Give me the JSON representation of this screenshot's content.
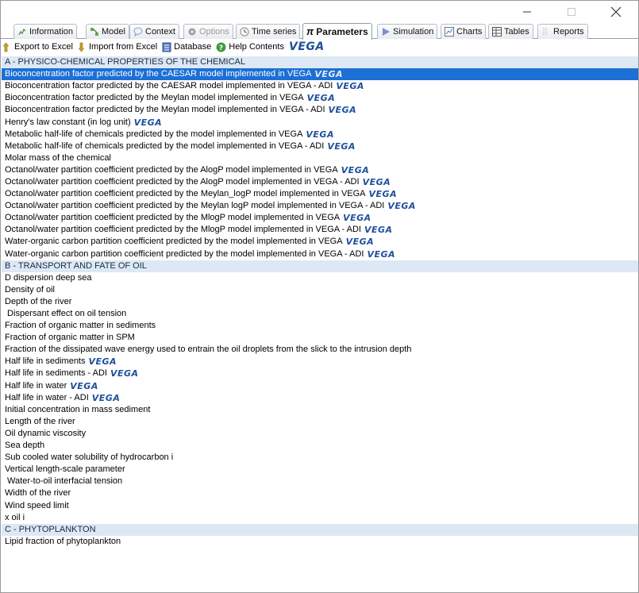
{
  "window": {
    "controls": {
      "minimize": "–",
      "maximize": "☐",
      "close": "✕"
    }
  },
  "tabs": [
    {
      "label": "Information",
      "icon": "info-icon",
      "state": "normal"
    },
    {
      "label": "Model",
      "icon": "model-icon",
      "state": "normal"
    },
    {
      "label": "Context",
      "icon": "context-bubble-icon",
      "state": "normal"
    },
    {
      "label": "Options",
      "icon": "options-gear-icon",
      "state": "disabled"
    },
    {
      "label": "Time series",
      "icon": "clock-icon",
      "state": "normal"
    },
    {
      "label": "Parameters",
      "icon": "pi-icon",
      "state": "active"
    },
    {
      "label": "Simulation",
      "icon": "play-icon",
      "state": "normal"
    },
    {
      "label": "Charts",
      "icon": "chart-icon",
      "state": "normal"
    },
    {
      "label": "Tables",
      "icon": "table-icon",
      "state": "normal"
    },
    {
      "label": "Reports",
      "icon": "report-icon",
      "state": "normal"
    }
  ],
  "toolbar": {
    "export_label": "Export to Excel",
    "import_label": "Import from Excel",
    "database_label": "Database",
    "help_label": "Help Contents",
    "vega_logo": "VEGA"
  },
  "vega_badge": "VEGA",
  "colors": {
    "selection": "#1c6fd4",
    "section_header": "#dde8f5",
    "vega_blue": "#1e4f9a"
  },
  "sections": [
    {
      "title": "A - PHYSICO-CHEMICAL PROPERTIES OF THE CHEMICAL",
      "items": [
        {
          "label": "Bioconcentration factor predicted by the CAESAR model implemented in VEGA",
          "vega": true,
          "selected": true
        },
        {
          "label": "Bioconcentration factor predicted by the CAESAR model implemented in VEGA - ADI",
          "vega": true
        },
        {
          "label": "Bioconcentration factor predicted by the Meylan model implemented in VEGA",
          "vega": true
        },
        {
          "label": "Bioconcentration factor predicted by the Meylan model implemented in VEGA - ADI",
          "vega": true
        },
        {
          "label": "Henry's law constant (in log unit)",
          "vega": true
        },
        {
          "label": "Metabolic half-life of chemicals predicted by the model implemented in VEGA",
          "vega": true
        },
        {
          "label": "Metabolic half-life of chemicals predicted by the model implemented in VEGA - ADI",
          "vega": true
        },
        {
          "label": "Molar mass of the chemical",
          "vega": false
        },
        {
          "label": "Octanol/water partition coefficient predicted by the AlogP model implemented in VEGA",
          "vega": true
        },
        {
          "label": "Octanol/water partition coefficient predicted by the AlogP model implemented in VEGA - ADI",
          "vega": true
        },
        {
          "label": "Octanol/water partition coefficient predicted by the Meylan_logP model implemented in VEGA",
          "vega": true
        },
        {
          "label": "Octanol/water partition coefficient predicted by the Meylan logP model implemented in VEGA - ADI",
          "vega": true
        },
        {
          "label": "Octanol/water partition coefficient predicted by the MlogP model implemented in VEGA",
          "vega": true
        },
        {
          "label": "Octanol/water partition coefficient predicted by the MlogP model implemented in VEGA - ADI",
          "vega": true
        },
        {
          "label": "Water-organic carbon partition coefficient predicted by the model implemented in VEGA",
          "vega": true
        },
        {
          "label": "Water-organic carbon partition coefficient predicted by the model implemented in VEGA - ADI",
          "vega": true
        }
      ]
    },
    {
      "title": "B - TRANSPORT AND FATE OF OIL",
      "items": [
        {
          "label": "D dispersion deep sea",
          "vega": false
        },
        {
          "label": "Density of oil",
          "vega": false
        },
        {
          "label": "Depth of the river",
          "vega": false
        },
        {
          "label": " Dispersant effect on oil tension",
          "vega": false
        },
        {
          "label": "Fraction of organic matter in sediments",
          "vega": false
        },
        {
          "label": "Fraction of organic matter in SPM",
          "vega": false
        },
        {
          "label": "Fraction of the dissipated wave energy used to entrain the oil droplets from the slick to the intrusion depth",
          "vega": false
        },
        {
          "label": "Half life in sediments",
          "vega": true
        },
        {
          "label": "Half life in sediments - ADI",
          "vega": true
        },
        {
          "label": "Half life in water",
          "vega": true
        },
        {
          "label": "Half life in water - ADI",
          "vega": true
        },
        {
          "label": "Initial concentration in mass sediment",
          "vega": false
        },
        {
          "label": "Length of the river",
          "vega": false
        },
        {
          "label": "Oil dynamic viscosity",
          "vega": false
        },
        {
          "label": "Sea depth",
          "vega": false
        },
        {
          "label": "Sub cooled water solubility of hydrocarbon i",
          "vega": false
        },
        {
          "label": "Vertical length-scale parameter",
          "vega": false
        },
        {
          "label": " Water-to-oil interfacial tension",
          "vega": false
        },
        {
          "label": "Width of the river",
          "vega": false
        },
        {
          "label": "Wind speed limit",
          "vega": false
        },
        {
          "label": "x oil i",
          "vega": false
        }
      ]
    },
    {
      "title": "C - PHYTOPLANKTON",
      "items": [
        {
          "label": "Lipid fraction of phytoplankton",
          "vega": false
        }
      ]
    }
  ]
}
